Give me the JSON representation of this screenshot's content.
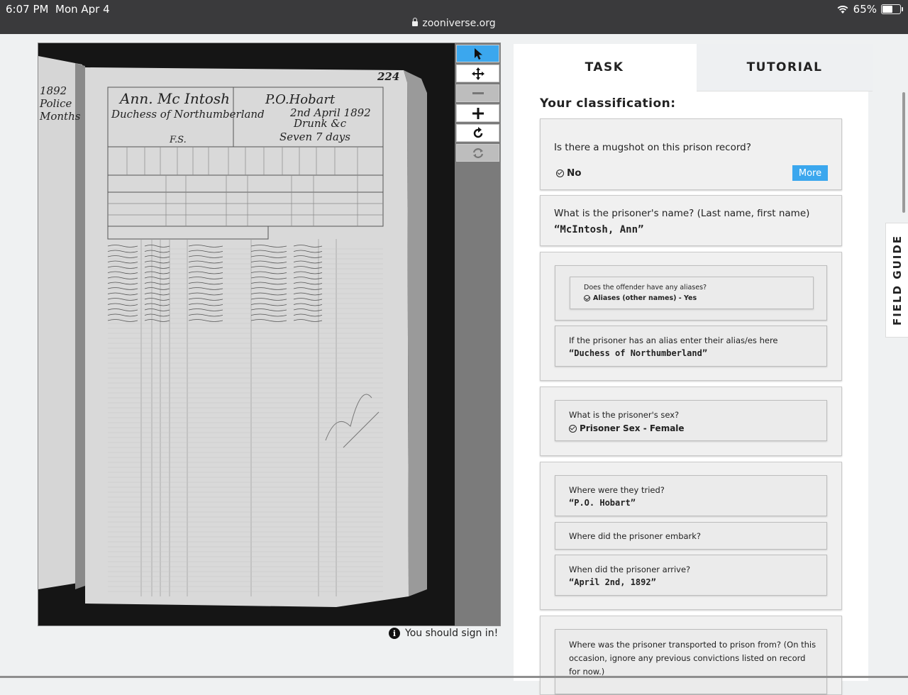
{
  "status_bar": {
    "time": "6:07 PM",
    "date": "Mon Apr 4",
    "url": "zooniverse.org",
    "battery": "65%",
    "battery_level": 0.65
  },
  "viewer": {
    "page_number": "224",
    "record_name": "Ann. Mc Intosh",
    "record_alias": "Duchess of Northumberland",
    "record_transported": "P.O.Hobart",
    "record_date": "2nd April 1892",
    "record_offence": "Drunk &c",
    "record_sentence": "Seven 7 days",
    "record_initials": "F.S.",
    "sign_in_text": "You should sign in!"
  },
  "tools": [
    "pointer-tool",
    "pan-tool",
    "zoom-out-tool",
    "zoom-in-tool",
    "rotate-tool",
    "reset-tool"
  ],
  "tabs": {
    "task": "TASK",
    "tutorial": "TUTORIAL"
  },
  "classification": {
    "title": "Your classification:",
    "q1": {
      "question": "Is there a mugshot on this prison record?",
      "answer": "No",
      "more": "More"
    },
    "q2": {
      "question": "What is the prisoner's name? (Last name, first name)",
      "answer": "“McIntosh, Ann”"
    },
    "q3": {
      "question": "Does the offender have any aliases?",
      "answer": "Aliases (other names) - Yes"
    },
    "q4": {
      "question": "If the prisoner has an alias enter their alias/es here",
      "answer": "“Duchess of Northumberland”"
    },
    "q5": {
      "question": "What is the prisoner's sex?",
      "answer": "Prisoner Sex - Female"
    },
    "q6": {
      "question": "Where were they tried?",
      "answer": "“P.O. Hobart”"
    },
    "q7": {
      "question": "Where did the prisoner embark?"
    },
    "q8": {
      "question": "When did the prisoner arrive?",
      "answer": "“April 2nd, 1892”"
    },
    "q9": {
      "question": "Where was the prisoner transported to prison from? (On this occasion, ignore any previous convictions listed on record for now.)"
    }
  },
  "field_guide": "FIELD GUIDE",
  "colors": {
    "accent": "#3ba7ee",
    "status_bar": "#3a3a3c"
  }
}
